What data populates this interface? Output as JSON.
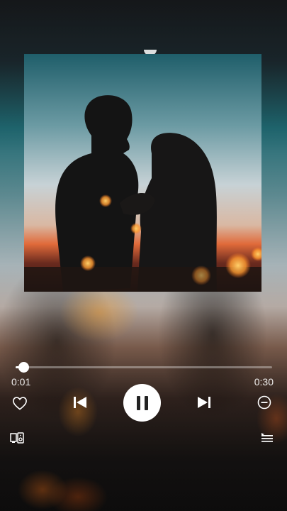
{
  "player": {
    "current_time": "0:01",
    "total_time": "0:30",
    "progress": 0.03,
    "state": "playing"
  },
  "controls": {
    "like_icon": "heart-icon",
    "prev_icon": "skip-previous-icon",
    "play_pause_icon": "pause-icon",
    "next_icon": "skip-next-icon",
    "remove_icon": "minus-circle-icon",
    "device_icon": "device-output-icon",
    "queue_icon": "queue-list-icon"
  },
  "colors": {
    "accent": "#ffffff",
    "track": "#9aa0a3"
  }
}
